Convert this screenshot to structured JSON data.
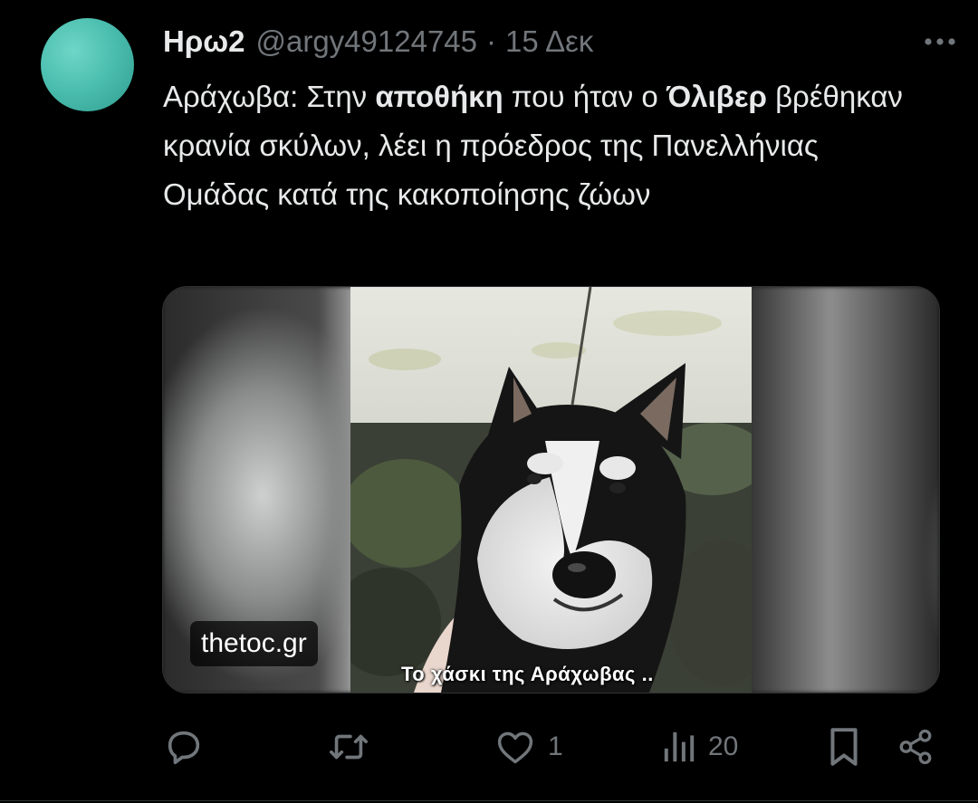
{
  "tweet": {
    "display_name": "Ηρω2",
    "handle": "@argy49124745",
    "separator": "·",
    "date": "15 Δεκ",
    "text_parts": [
      "Αράχωβα: Στην ",
      "αποθήκη",
      " που ήταν ο ",
      "Όλιβερ",
      " βρέθηκαν κρανία σκύλων, λέει η πρόεδρος της Πανελλήνιας Ομάδας κατά της κακοποίησης ζώων"
    ]
  },
  "card": {
    "source_label": "thetoc.gr",
    "image_caption": "Το χάσκι της Αράχωβας .."
  },
  "actions": {
    "reply_count": "",
    "retweet_count": "",
    "like_count": "1",
    "views_count": "20"
  },
  "colors": {
    "background": "#000000",
    "text_primary": "#e7e9ea",
    "text_secondary": "#71767b",
    "avatar": "#4cbfb0"
  },
  "icons": [
    "more-icon",
    "reply-icon",
    "retweet-icon",
    "like-icon",
    "views-icon",
    "bookmark-icon",
    "share-icon"
  ]
}
